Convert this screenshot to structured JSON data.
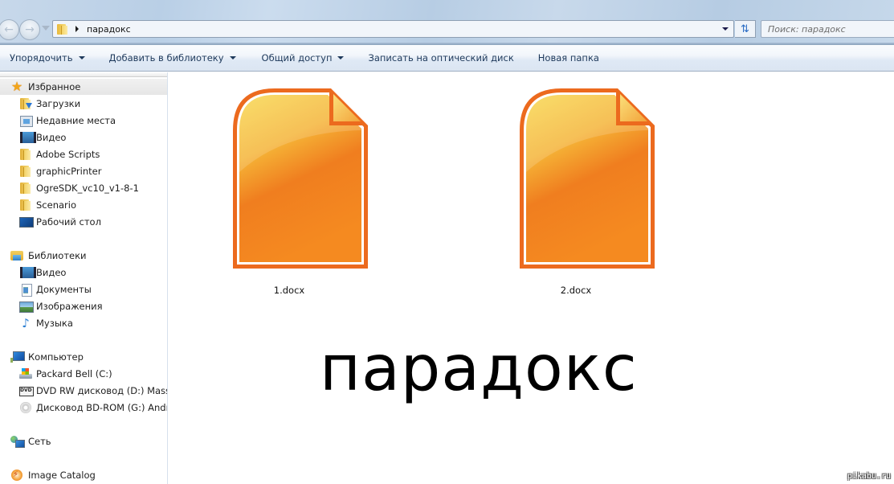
{
  "window": {
    "address_path": [
      "парадокс"
    ],
    "search_placeholder": "Поиск: парадокс"
  },
  "icons": {
    "back": "arrow-left-icon",
    "forward": "arrow-right-icon",
    "refresh": "refresh-icon",
    "folder": "folder-icon"
  },
  "toolbar": {
    "items": [
      {
        "label": "Упорядочить",
        "has_menu": true
      },
      {
        "label": "Добавить в библиотеку",
        "has_menu": true
      },
      {
        "label": "Общий доступ",
        "has_menu": true
      },
      {
        "label": "Записать на оптический диск",
        "has_menu": false
      },
      {
        "label": "Новая папка",
        "has_menu": false
      }
    ]
  },
  "sidebar": {
    "favorites": {
      "label": "Избранное",
      "icon": "star-icon",
      "items": [
        {
          "label": "Загрузки",
          "icon": "downloads-icon"
        },
        {
          "label": "Недавние места",
          "icon": "recent-places-icon"
        },
        {
          "label": "Видео",
          "icon": "video-icon"
        },
        {
          "label": "Adobe Scripts",
          "icon": "folder-icon"
        },
        {
          "label": "graphicPrinter",
          "icon": "folder-icon"
        },
        {
          "label": "OgreSDK_vc10_v1-8-1",
          "icon": "folder-icon"
        },
        {
          "label": "Scenario",
          "icon": "folder-icon"
        },
        {
          "label": "Рабочий стол",
          "icon": "desktop-icon"
        }
      ]
    },
    "libraries": {
      "label": "Библиотеки",
      "icon": "library-icon",
      "items": [
        {
          "label": "Видео",
          "icon": "video-icon"
        },
        {
          "label": "Документы",
          "icon": "documents-icon"
        },
        {
          "label": "Изображения",
          "icon": "images-icon"
        },
        {
          "label": "Музыка",
          "icon": "music-icon"
        }
      ]
    },
    "computer": {
      "label": "Компьютер",
      "icon": "computer-icon",
      "items": [
        {
          "label": "Packard Bell (C:)",
          "icon": "hard-drive-icon"
        },
        {
          "label": "DVD RW дисковод (D:) MassEff",
          "icon": "dvd-drive-icon"
        },
        {
          "label": "Дисковод BD-ROM (G:) Androi",
          "icon": "disc-drive-icon"
        }
      ]
    },
    "network": {
      "label": "Сеть",
      "icon": "network-icon"
    },
    "image_catalog": {
      "label": "Image Catalog",
      "icon": "image-catalog-icon"
    }
  },
  "content": {
    "files": [
      {
        "name": "1.docx",
        "icon": "document-file-icon"
      },
      {
        "name": "2.docx",
        "icon": "document-file-icon"
      }
    ],
    "overlay_text": "парадокс",
    "watermark": "pikabu.ru"
  },
  "colors": {
    "file_icon_orange": "#f08a24",
    "file_icon_yellow": "#f7d14a",
    "file_icon_border": "#ec6a1e",
    "toolbar_text": "#1e395b"
  }
}
